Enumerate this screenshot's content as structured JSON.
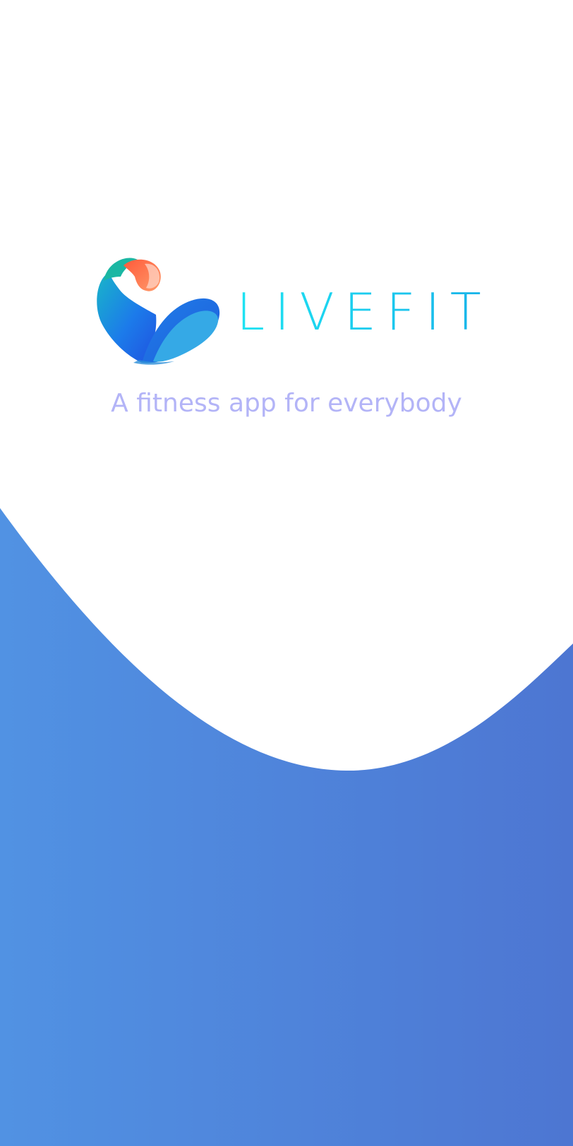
{
  "app": {
    "name": "LIVEFIT",
    "tagline": "A fitness app for everybody"
  },
  "logo": {
    "icon": "flexed-arm-logo-icon"
  },
  "colors": {
    "background": "#ffffff",
    "wave_gradient_start": "#5192e3",
    "wave_gradient_end": "#4d76d2",
    "wordmark_start": "#1ee3f2",
    "wordmark_end": "#19b2e8",
    "tagline": "#b3b4f7",
    "logo_orange": "#f26a4a",
    "logo_teal": "#1bb7a3",
    "logo_blue": "#2f6fe8",
    "logo_sky": "#35a9e6"
  }
}
